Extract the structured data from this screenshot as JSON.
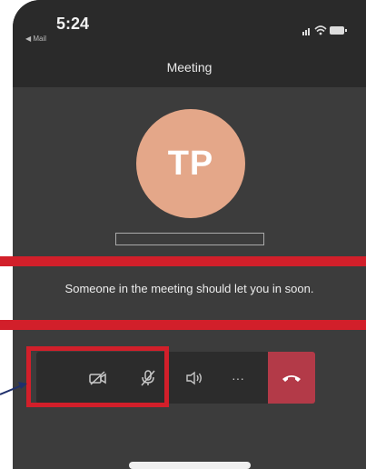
{
  "status_bar": {
    "time": "5:24",
    "back_app": "◀ Mail",
    "icons": [
      "signal-icon",
      "wifi-icon",
      "battery-icon"
    ]
  },
  "nav": {
    "title": "Meeting"
  },
  "participant": {
    "initials": "TP",
    "avatar_color": "#e4a789"
  },
  "lobby": {
    "message": "Someone in the meeting should let you in soon."
  },
  "toolbar": {
    "buttons": [
      {
        "name": "camera-off",
        "icon": "camera-off-icon"
      },
      {
        "name": "mic-off",
        "icon": "mic-off-icon"
      },
      {
        "name": "speaker",
        "icon": "speaker-icon"
      },
      {
        "name": "more",
        "icon": "more-icon",
        "label": "···"
      },
      {
        "name": "hang-up",
        "icon": "phone-hangup-icon",
        "color": "#b33a48"
      }
    ]
  },
  "annotation_color": "#d21f2a"
}
